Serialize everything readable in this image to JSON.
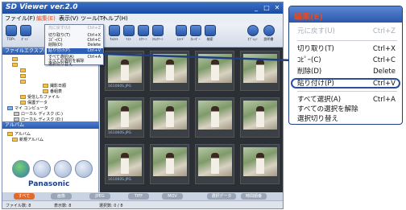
{
  "window": {
    "title": "SD Viewer ver.2.0",
    "controls": [
      "_",
      "□",
      "✕"
    ]
  },
  "menubar": [
    "ファイル(F)",
    "編集(E)",
    "表示(V)",
    "ツール(T)",
    "ヘルプ(H)"
  ],
  "toolbar": [
    "TOPﾍ",
    "ﾀﾞｲｼﾞ",
    "",
    "",
    "",
    "",
    "",
    "",
    "",
    "ｻﾑﾈｲﾙ",
    "ﾘｽﾄ",
    "ｽｸﾘｰﾝ",
    "ﾌﾙｽｸﾘｰﾝ",
    "ｽﾗｲﾄﾞ",
    "ｶﾚﾝﾀﾞｰ",
    "検索",
    "ｵﾌﾟｼｮﾝ",
    "説明書"
  ],
  "left_panel": {
    "header1": "ファイルエクスプローラ",
    "tree": [
      "",
      "",
      "",
      "",
      "",
      "撮影日順",
      "番組表",
      "受信したファイル",
      "保護データ",
      "マイ コンピュータ",
      "ローカル ディスク (C:)",
      "ローカル ディスク (D:)"
    ],
    "header2": "アルバム",
    "album_items": [
      "アルバム",
      "新規アルバム"
    ],
    "brand": "Panasonic"
  },
  "thumbnails": [
    "161060S.JPG",
    "",
    "",
    "",
    "161060S.JPG",
    "",
    "",
    "",
    "161060S.JPG",
    "",
    "",
    ""
  ],
  "tabs": [
    "すべて",
    "画像",
    "JPEG",
    "TIFF",
    "MOV",
    "選択データ",
    "時間順番"
  ],
  "status": [
    "ファイル数: 8",
    "表示数: 8",
    "選択数: 0 / 8"
  ],
  "small_menu": {
    "items": [
      {
        "label": "元に戻す(U)",
        "key": "Ctrl+Z",
        "state": "dim"
      },
      {
        "label": "切り取り(T)",
        "key": "Ctrl+X",
        "state": ""
      },
      {
        "label": "ｺﾋﾟｰ(C)",
        "key": "Ctrl+C",
        "state": ""
      },
      {
        "label": "削除(D)",
        "key": "Delete",
        "state": ""
      },
      {
        "label": "貼り付け(P)",
        "key": "Ctrl+V",
        "state": "hl"
      },
      {
        "label": "すべて選択(A)",
        "key": "Ctrl+A",
        "state": ""
      },
      {
        "label": "すべての選択を解除",
        "key": "",
        "state": ""
      },
      {
        "label": "選択切り替え",
        "key": "",
        "state": ""
      }
    ]
  },
  "zoom_menu": {
    "title": "編集(E)",
    "items": [
      {
        "label": "元に戻す(U)",
        "key": "Ctrl+Z",
        "state": "dim"
      },
      {
        "label": "切り取り(T)",
        "key": "Ctrl+X",
        "state": ""
      },
      {
        "label": "ｺﾋﾟｰ(C)",
        "key": "Ctrl+C",
        "state": ""
      },
      {
        "label": "削除(D)",
        "key": "Delete",
        "state": ""
      },
      {
        "label": "貼り付け(P)",
        "key": "Ctrl+V",
        "state": "hl"
      },
      {
        "label": "すべて選択(A)",
        "key": "Ctrl+A",
        "state": ""
      },
      {
        "label": "すべての選択を解除",
        "key": "",
        "state": ""
      },
      {
        "label": "選択切り替え",
        "key": "",
        "state": ""
      }
    ]
  },
  "colors": {
    "accent": "#e8491d",
    "title_blue": "#2c58ab",
    "highlight_ring": "#2c4f99"
  }
}
